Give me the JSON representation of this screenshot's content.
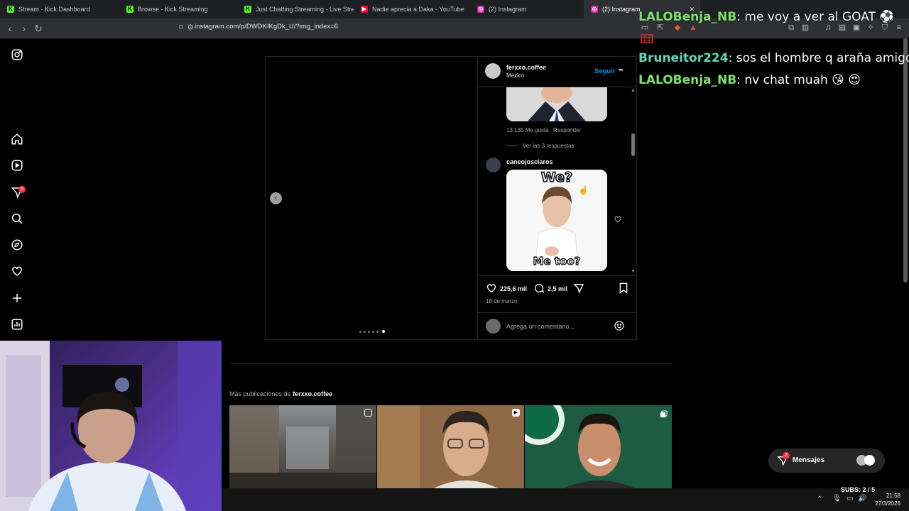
{
  "browser": {
    "tabs": [
      {
        "label": "Stream - Kick Dashboard",
        "favicon": "kick-icon",
        "active": false
      },
      {
        "label": "Browse - Kick Streaming",
        "favicon": "kick-icon",
        "active": false
      },
      {
        "label": "Just Chatting Streaming - Live Stream",
        "favicon": "kick-icon",
        "active": false
      },
      {
        "label": "Nadie aprecia a Daka - YouTube",
        "favicon": "youtube-icon",
        "active": false
      },
      {
        "label": "(2) Instagram",
        "favicon": "instagram-icon",
        "active": false
      },
      {
        "label": "(2) Instagram",
        "favicon": "instagram-icon",
        "active": true
      }
    ],
    "url": "instagram.com/p/DWDKIKgDk_U/?img_index=6"
  },
  "instagram": {
    "nav_badge": "5",
    "post": {
      "author": "ferxxo.coffee",
      "location": "México",
      "follow_label": "Seguir",
      "more_label": "•••",
      "likes": "225,6 mil",
      "comments": "2,5 mil",
      "date": "18 de marzo",
      "comment_placeholder": "Agrega un comentario...",
      "image_index": 6,
      "image_count": 6
    },
    "comments": [
      {
        "likes_text": "13.135 Me gusta",
        "reply_label": "Responder",
        "view_replies": "Ver las 3 respuestas"
      },
      {
        "username": "caneojosclaros",
        "meme_top": "We?",
        "meme_bottom": "Me too?"
      }
    ],
    "more_posts": {
      "prefix": "Más publicaciones de ",
      "author": "ferxxo.coffee"
    },
    "messages_label": "Mensajes",
    "messages_badge": "2"
  },
  "chat": [
    {
      "user": "LALOBenja_NB",
      "text": ": me voy a ver al GOAT ⚽"
    },
    {
      "user": "Bruneitor224",
      "text": ": sos el hombre q araña amigo"
    },
    {
      "user": "LALOBenja_NB",
      "text": ": nv chat muah 😘 😍"
    }
  ],
  "stream": {
    "subs": "SUBS: 2 / 5"
  },
  "clock": {
    "time": "21:58",
    "date": "27/3/2026"
  },
  "colors": {
    "ig_blue": "#0095f6",
    "chat_green": "#7ee36b",
    "chat_teal": "#62d3b9",
    "notif_red": "#ff3040"
  }
}
